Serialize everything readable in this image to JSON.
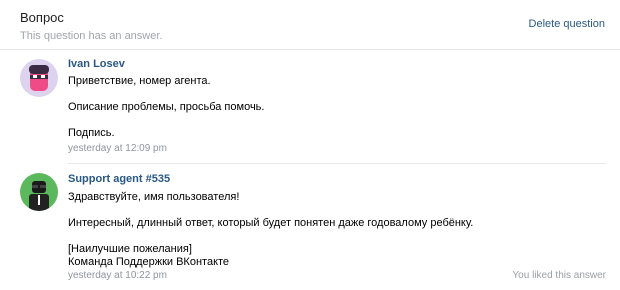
{
  "header": {
    "title": "Вопрос",
    "subtitle": "This question has an answer.",
    "delete_label": "Delete question"
  },
  "messages": [
    {
      "author": "Ivan Losev",
      "lines": [
        "Приветствие, номер агента.",
        "Описание проблемы, просьба помочь.",
        "Подпись."
      ],
      "time": "yesterday at 12:09 pm",
      "avatar_icon": "pink-helmet-avatar-icon"
    },
    {
      "author": "Support agent #535",
      "lines": [
        "Здравствуйте, имя пользователя!",
        "Интересный, длинный ответ, который будет понятен даже годовалому ребёнку.",
        "[Наилучшие пожелания]",
        "Команда Поддержки ВКонтакте"
      ],
      "time": "yesterday at 10:22 pm",
      "liked": "You liked this answer",
      "avatar_icon": "agent-sunglasses-avatar-icon"
    }
  ],
  "colors": {
    "link": "#2a5885",
    "meta": "#8e959c",
    "divider": "#e7e8ec"
  }
}
